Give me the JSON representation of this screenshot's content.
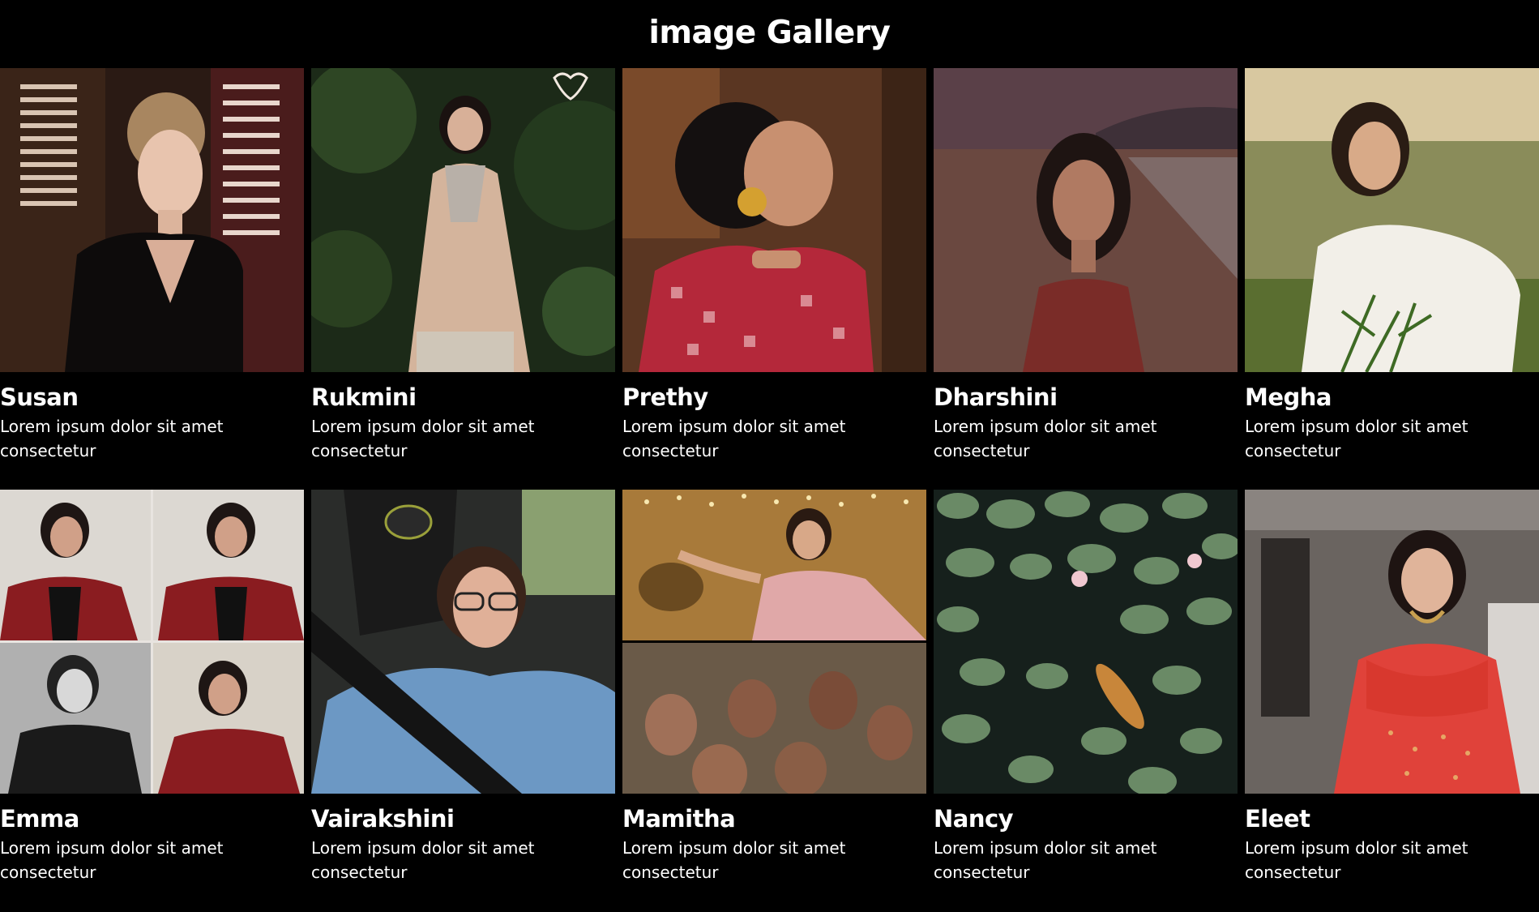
{
  "page": {
    "title": "image Gallery",
    "background": "#000000"
  },
  "gallery": {
    "items": [
      {
        "name": "Susan",
        "description": "Lorem ipsum dolor sit amet consectetur",
        "photo": "woman-portrait-window-shutters"
      },
      {
        "name": "Rukmini",
        "description": "Lorem ipsum dolor sit amet consectetur",
        "photo": "woman-beige-saree-garden"
      },
      {
        "name": "Prethy",
        "description": "Lorem ipsum dolor sit amet consectetur",
        "photo": "woman-red-print-earring"
      },
      {
        "name": "Dharshini",
        "description": "Lorem ipsum dolor sit amet consectetur",
        "photo": "woman-beach-sunset"
      },
      {
        "name": "Megha",
        "description": "Lorem ipsum dolor sit amet consectetur",
        "photo": "woman-white-shirt-field"
      },
      {
        "name": "Emma",
        "description": "Lorem ipsum dolor sit amet consectetur",
        "photo": "photo-collage-four-portraits"
      },
      {
        "name": "Vairakshini",
        "description": "Lorem ipsum dolor sit amet consectetur",
        "photo": "woman-selfie-car-glasses"
      },
      {
        "name": "Mamitha",
        "description": "Lorem ipsum dolor sit amet consectetur",
        "photo": "film-stills-dance-audience"
      },
      {
        "name": "Nancy",
        "description": "Lorem ipsum dolor sit amet consectetur",
        "photo": "lily-pond-koi"
      },
      {
        "name": "Eleet",
        "description": "Lorem ipsum dolor sit amet consectetur",
        "photo": "woman-red-lehenga"
      }
    ]
  }
}
